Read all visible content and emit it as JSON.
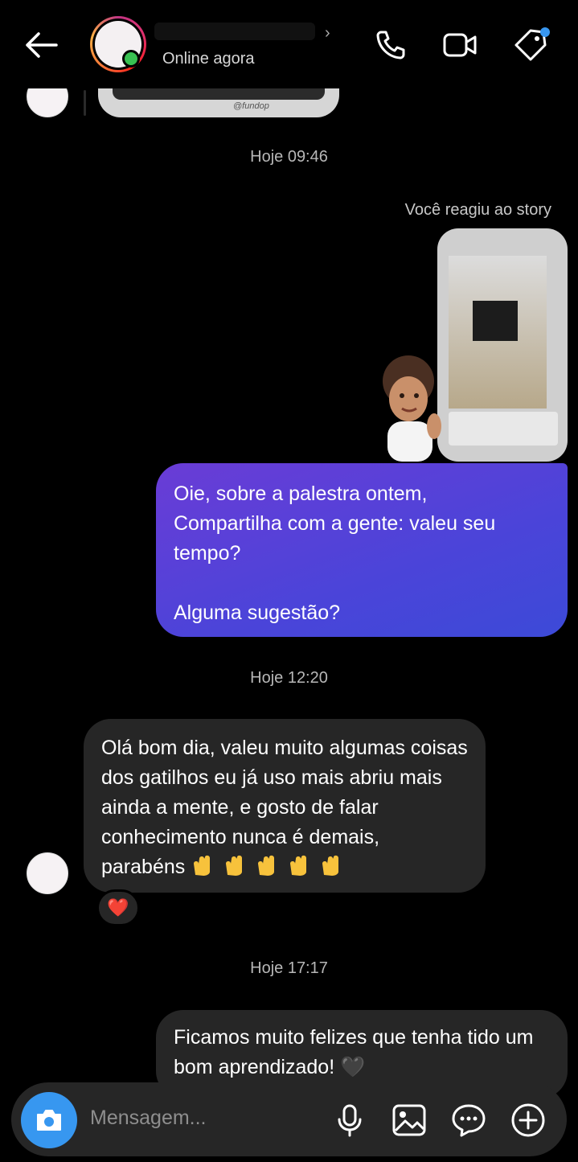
{
  "header": {
    "status": "Online agora",
    "icons": [
      "back-arrow-icon",
      "phone-icon",
      "video-icon",
      "tag-icon"
    ]
  },
  "thread": {
    "story_tag": "@fundop",
    "timestamp_1": "Hoje 09:46",
    "reacted_label": "Você reagiu ao story",
    "message_1": "Oie, sobre a palestra ontem,\nCompartilha com a gente: valeu seu tempo?\n\nAlguma sugestão?",
    "timestamp_2": "Hoje 12:20",
    "message_2": "Olá bom dia, valeu muito algumas coisas dos gatilhos eu já uso mais abriu mais ainda a mente, e gosto de falar conhecimento nunca é demais, parabéns",
    "message_2_emoji_count": 5,
    "reaction": "❤️",
    "timestamp_3": "Hoje 17:17",
    "message_3": "Ficamos muito felizes que tenha tido um bom aprendizado! 🖤"
  },
  "composer": {
    "placeholder": "Mensagem...",
    "icons": [
      "camera-icon",
      "microphone-icon",
      "gallery-icon",
      "sticker-icon",
      "plus-icon"
    ]
  },
  "colors": {
    "accent_blue": "#3797f0",
    "bubble_gradient_start": "#6a3cd6",
    "bubble_gradient_end": "#3c4ad8",
    "bubble_dark": "#262626",
    "online_green": "#39c152"
  }
}
